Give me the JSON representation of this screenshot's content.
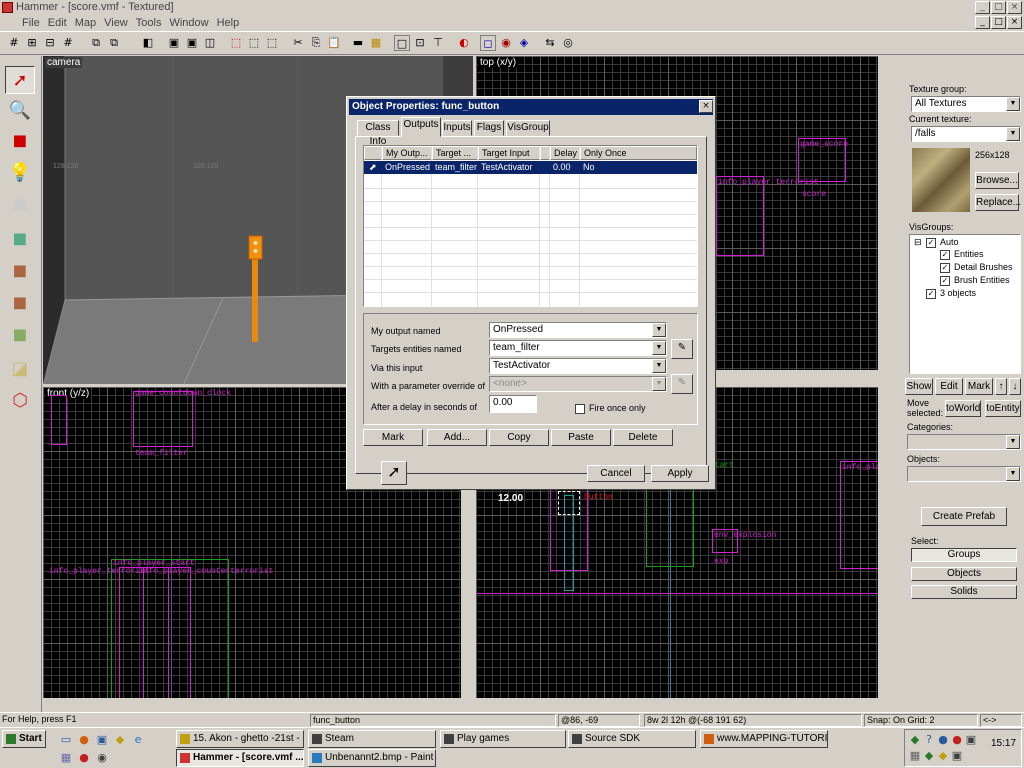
{
  "window": {
    "title": "Hammer - [score.vmf - Textured]"
  },
  "menu": [
    "File",
    "Edit",
    "Map",
    "View",
    "Tools",
    "Window",
    "Help"
  ],
  "views": {
    "camera": "camera",
    "top": "top (x/y)",
    "front": "front (y/z)",
    "side_readout": "12.00"
  },
  "entities": {
    "gamecountdown": "game_countdown_clock",
    "teamfilter": "team_filter",
    "info_player_start": "info_player_start",
    "info_player_terrorist": "info_player_terrorist",
    "info_player_counterterrorist": "info_player_counterterrorist",
    "game_score": "game_score",
    "score": "score",
    "env_explosion": "env_explosion",
    "exp": "exp",
    "button": "button",
    "start": "start",
    "info_player_t": "info_player"
  },
  "dialog": {
    "title": "Object Properties: func_button",
    "tabs": [
      "Class Info",
      "Outputs",
      "Inputs",
      "Flags",
      "VisGroup"
    ],
    "columns": [
      "My Outp...",
      "Target ...",
      "Target Input",
      "Delay",
      "Only Once"
    ],
    "row": [
      "OnPressed",
      "team_filter",
      "TestActivator",
      "0.00",
      "No"
    ],
    "labels": {
      "output_named": "My output named",
      "targets": "Targets entities named",
      "via_input": "Via this input",
      "param": "With a parameter override of",
      "delay": "After a delay in seconds of",
      "fire_once": "Fire once only"
    },
    "values": {
      "output": "OnPressed",
      "target": "team_filter",
      "input": "TestActivator",
      "param": "<none>",
      "delay": "0.00"
    },
    "buttons": {
      "mark": "Mark",
      "add": "Add...",
      "copy": "Copy",
      "paste": "Paste",
      "delete": "Delete",
      "cancel": "Cancel",
      "apply": "Apply"
    }
  },
  "panel": {
    "texture_group_label": "Texture group:",
    "texture_group": "All Textures",
    "current_texture_label": "Current texture:",
    "current_texture": "/falls",
    "texture_size": "256x128",
    "browse": "Browse...",
    "replace": "Replace...",
    "visgroups_label": "VisGroups:",
    "visgroups": [
      "Auto",
      "Entities",
      "Detail Brushes",
      "Brush Entities",
      "3 objects"
    ],
    "show": "Show",
    "edit": "Edit",
    "mark": "Mark",
    "move_selected": "Move selected:",
    "toworld": "toWorld",
    "toentity": "toEntity",
    "categories_label": "Categories:",
    "objects_label": "Objects:",
    "create_prefab": "Create Prefab",
    "select_label": "Select:",
    "groups": "Groups",
    "objects": "Objects",
    "solids": "Solids"
  },
  "status": {
    "help": "For Help, press F1",
    "selection": "func_button",
    "coords": "@86, -69",
    "size": "8w 2l 12h @(-68 191 62)",
    "snap": "Snap: On Grid: 2",
    "extra": "<->"
  },
  "taskbar": {
    "start": "Start",
    "tasks": [
      "15. Akon - ghetto -21st - ...",
      "Steam",
      "Play games",
      "Source SDK",
      "www.MAPPING-TUTORIA...",
      "Hammer - [score.vmf ...",
      "Unbenannt2.bmp - Paint"
    ],
    "clock": "15:17"
  },
  "colors": {
    "entity": "#d020d0",
    "brush": "#1a9a1a",
    "title_active": "#0a246a",
    "orange_button": "#f09010"
  }
}
